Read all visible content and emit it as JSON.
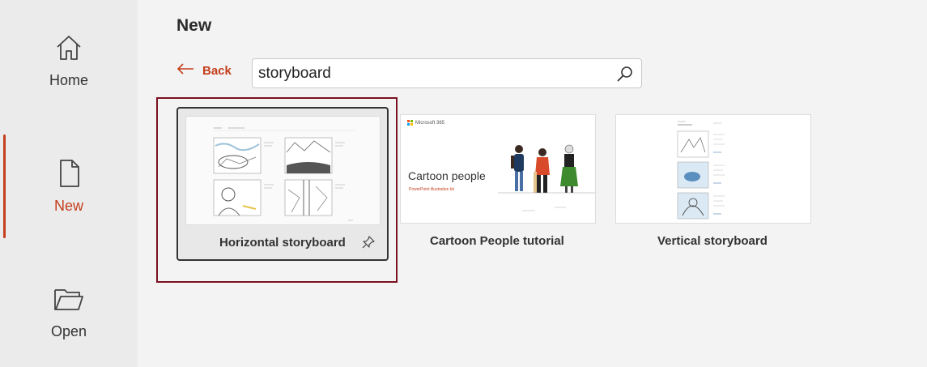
{
  "sidebar": {
    "items": [
      {
        "label": "Home",
        "icon": "home-icon"
      },
      {
        "label": "New",
        "icon": "new-document-icon",
        "active": true
      },
      {
        "label": "Open",
        "icon": "folder-icon"
      }
    ]
  },
  "main": {
    "title": "New",
    "back_label": "Back",
    "search": {
      "value": "storyboard",
      "placeholder": ""
    },
    "templates": [
      {
        "label": "Horizontal storyboard",
        "selected": true,
        "pin_icon": "pin-icon"
      },
      {
        "label": "Cartoon People tutorial",
        "thumb_title": "Cartoon people",
        "thumb_subtitle": "PowerPoint illustration kit",
        "thumb_brand": "Microsoft 365"
      },
      {
        "label": "Vertical storyboard"
      }
    ]
  },
  "colors": {
    "accent": "#c43e1c",
    "highlight": "#7a1020"
  }
}
